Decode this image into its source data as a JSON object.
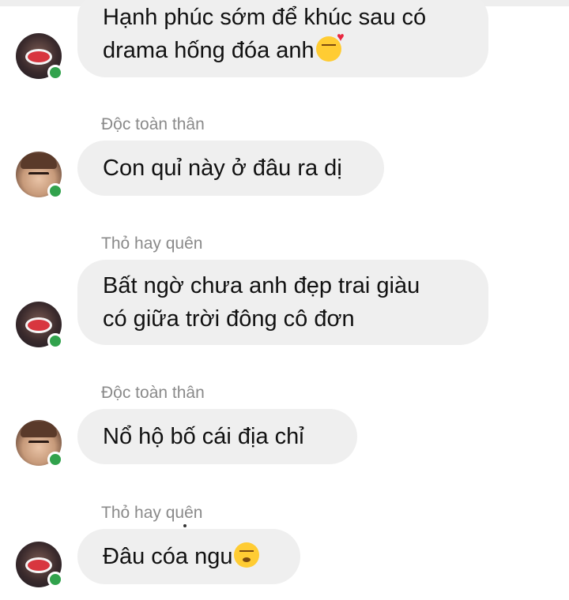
{
  "messages": [
    {
      "sender": "",
      "lines": [
        "Hạnh phúc sớm để khúc sau có",
        "drama hống đóa anh"
      ],
      "emoji": "kissing-heart"
    },
    {
      "sender": "Độc toàn thân",
      "lines": [
        "Con quỉ này ở đâu ra dị"
      ]
    },
    {
      "sender": "Thỏ hay quên",
      "lines": [
        "Bất ngờ chưa anh đẹp trai giàu",
        "có giữa trời đông cô đơn"
      ]
    },
    {
      "sender": "Độc toàn thân",
      "lines": [
        "Nổ hộ bố cái địa chỉ"
      ]
    },
    {
      "sender": "Thỏ hay quên",
      "lines": [
        "Đâu cóa ngu"
      ],
      "emoji": "kissing-smiling-eyes"
    }
  ],
  "colors": {
    "bubble": "#efefef",
    "sender_name": "#8a8a8a",
    "online": "#31a24c"
  }
}
